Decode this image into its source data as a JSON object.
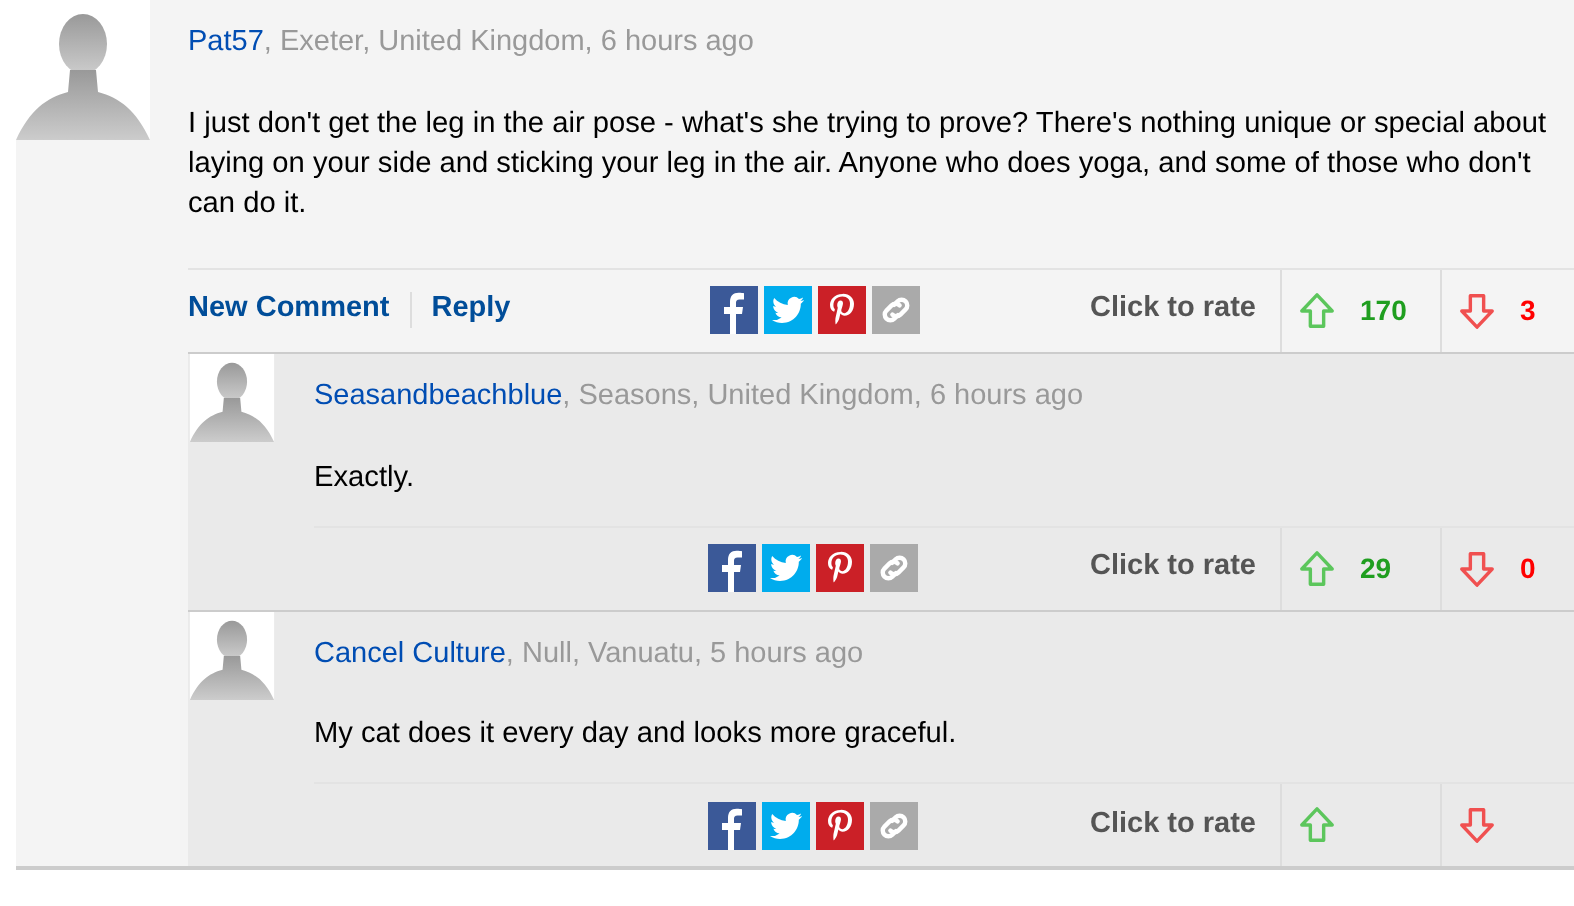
{
  "comment": {
    "author": "Pat57",
    "meta": ", Exeter, United Kingdom, 6 hours ago",
    "text": "I just don't get the leg in the air pose - what's she trying to prove? There's nothing unique or special about laying on your side and sticking your leg in the air. Anyone who does yoga, and some of those who don't can do it.",
    "actions": [
      "New Comment",
      "Reply"
    ],
    "rating": {
      "label": "Click to rate",
      "up": "170",
      "down": "3"
    },
    "replies": [
      {
        "author": "Seasandbeachblue",
        "meta": ", Seasons, United Kingdom, 6 hours ago",
        "text": "Exactly.",
        "rating": {
          "label": "Click to rate",
          "up": "29",
          "down": "0"
        }
      },
      {
        "author": "Cancel Culture",
        "meta": ", Null, Vanuatu, 5 hours ago",
        "text": "My cat does it every day and looks more graceful.",
        "rating": {
          "label": "Click to rate"
        }
      }
    ]
  }
}
